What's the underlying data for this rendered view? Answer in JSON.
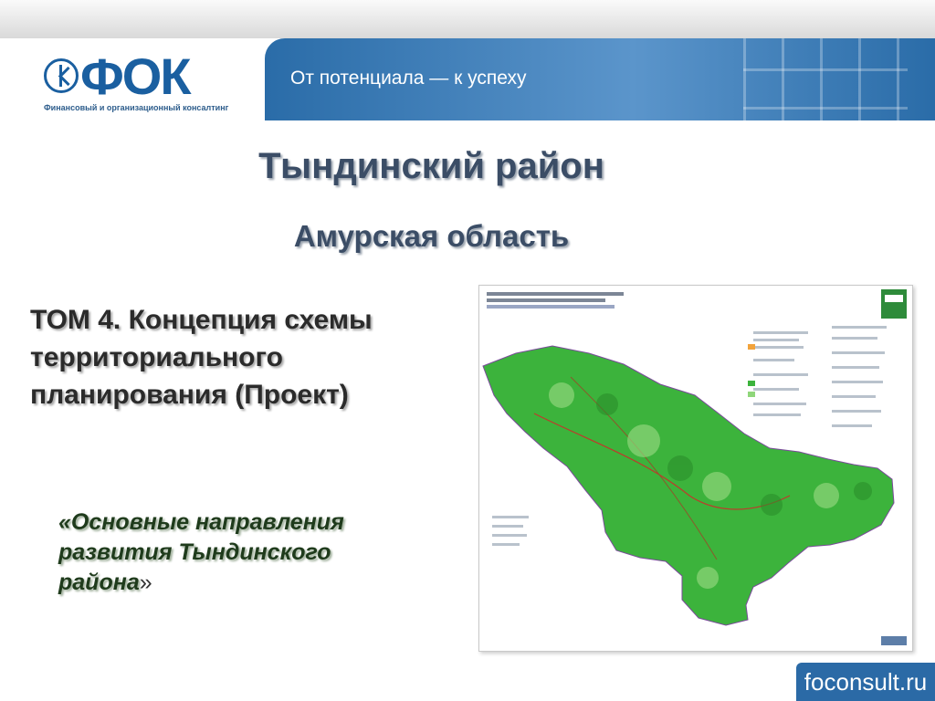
{
  "header": {
    "logo_text": "ФОК",
    "logo_sub": "Финансовый и организационный консалтинг",
    "slogan": "От потенциала — к успеху"
  },
  "main": {
    "title": "Тындинский район",
    "subtitle": "Амурская область",
    "volume_title": "ТОМ 4. Концепция схемы территориального планирования (Проект)",
    "directions_text": "«Основные направления развития Тындинского района",
    "directions_close": "»"
  },
  "map": {
    "icon": "district-map-image"
  },
  "footer": {
    "site": "foconsult.ru"
  },
  "colors": {
    "brand_blue": "#2b6aa6",
    "map_green": "#3cb33c",
    "title_color": "#3b4d66"
  }
}
